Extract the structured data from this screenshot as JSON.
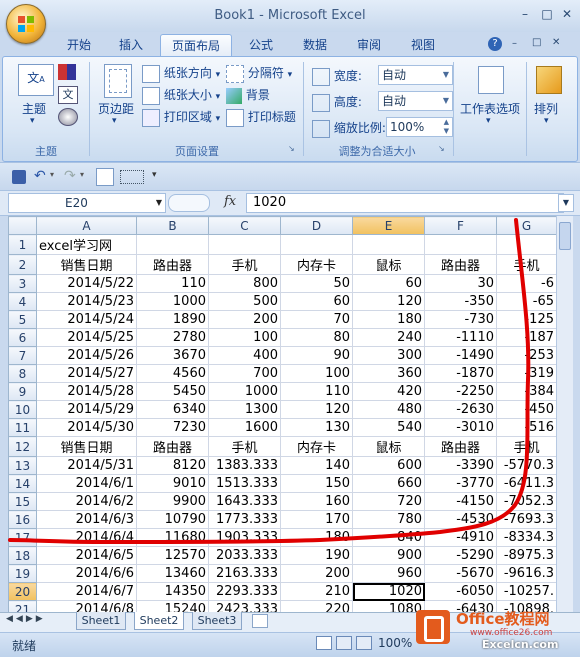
{
  "window": {
    "title": "Book1 - Microsoft Excel"
  },
  "tabs": [
    "开始",
    "插入",
    "页面布局",
    "公式",
    "数据",
    "审阅",
    "视图"
  ],
  "active_tab": "页面布局",
  "ribbon": {
    "theme": {
      "label": "主题",
      "btn": "主题"
    },
    "page_setup": {
      "margins": "页边距",
      "orientation": "纸张方向",
      "size": "纸张大小",
      "print_area": "打印区域",
      "breaks": "分隔符",
      "background": "背景",
      "print_titles": "打印标题",
      "label": "页面设置"
    },
    "scale": {
      "width_label": "宽度:",
      "width_value": "自动",
      "height_label": "高度:",
      "height_value": "自动",
      "scale_label": "缩放比例:",
      "scale_value": "100%",
      "label": "调整为合适大小"
    },
    "sheet_options": "工作表选项",
    "arrange": "排列"
  },
  "formula_bar": {
    "name_box": "E20",
    "fx": "fx",
    "value": "1020"
  },
  "columns": [
    "A",
    "B",
    "C",
    "D",
    "E",
    "F",
    "G"
  ],
  "rows": [
    {
      "n": "1",
      "cells": [
        "excel学习网",
        "",
        "",
        "",
        "",
        "",
        ""
      ]
    },
    {
      "n": "2",
      "cells": [
        "销售日期",
        "路由器",
        "手机",
        "内存卡",
        "鼠标",
        "路由器",
        "手机"
      ]
    },
    {
      "n": "3",
      "cells": [
        "2014/5/22",
        "110",
        "800",
        "50",
        "60",
        "30",
        "-6"
      ]
    },
    {
      "n": "4",
      "cells": [
        "2014/5/23",
        "1000",
        "500",
        "60",
        "120",
        "-350",
        "-65"
      ]
    },
    {
      "n": "5",
      "cells": [
        "2014/5/24",
        "1890",
        "200",
        "70",
        "180",
        "-730",
        "-125"
      ]
    },
    {
      "n": "6",
      "cells": [
        "2014/5/25",
        "2780",
        "100",
        "80",
        "240",
        "-1110",
        "-187"
      ]
    },
    {
      "n": "7",
      "cells": [
        "2014/5/26",
        "3670",
        "400",
        "90",
        "300",
        "-1490",
        "-253"
      ]
    },
    {
      "n": "8",
      "cells": [
        "2014/5/27",
        "4560",
        "700",
        "100",
        "360",
        "-1870",
        "-319"
      ]
    },
    {
      "n": "9",
      "cells": [
        "2014/5/28",
        "5450",
        "1000",
        "110",
        "420",
        "-2250",
        "-384"
      ]
    },
    {
      "n": "10",
      "cells": [
        "2014/5/29",
        "6340",
        "1300",
        "120",
        "480",
        "-2630",
        "-450"
      ]
    },
    {
      "n": "11",
      "cells": [
        "2014/5/30",
        "7230",
        "1600",
        "130",
        "540",
        "-3010",
        "-516"
      ]
    },
    {
      "n": "12",
      "cells": [
        "销售日期",
        "路由器",
        "手机",
        "内存卡",
        "鼠标",
        "路由器",
        "手机"
      ]
    },
    {
      "n": "13",
      "cells": [
        "2014/5/31",
        "8120",
        "1383.333",
        "140",
        "600",
        "-3390",
        "-5770.3"
      ]
    },
    {
      "n": "14",
      "cells": [
        "2014/6/1",
        "9010",
        "1513.333",
        "150",
        "660",
        "-3770",
        "-6411.3"
      ]
    },
    {
      "n": "15",
      "cells": [
        "2014/6/2",
        "9900",
        "1643.333",
        "160",
        "720",
        "-4150",
        "-7052.3"
      ]
    },
    {
      "n": "16",
      "cells": [
        "2014/6/3",
        "10790",
        "1773.333",
        "170",
        "780",
        "-4530",
        "-7693.3"
      ]
    },
    {
      "n": "17",
      "cells": [
        "2014/6/4",
        "11680",
        "1903.333",
        "180",
        "840",
        "-4910",
        "-8334.3"
      ]
    },
    {
      "n": "18",
      "cells": [
        "2014/6/5",
        "12570",
        "2033.333",
        "190",
        "900",
        "-5290",
        "-8975.3"
      ]
    },
    {
      "n": "19",
      "cells": [
        "2014/6/6",
        "13460",
        "2163.333",
        "200",
        "960",
        "-5670",
        "-9616.3"
      ]
    },
    {
      "n": "20",
      "cells": [
        "2014/6/7",
        "14350",
        "2293.333",
        "210",
        "1020",
        "-6050",
        "-10257."
      ]
    },
    {
      "n": "21",
      "cells": [
        "2014/6/8",
        "15240",
        "2423.333",
        "220",
        "1080",
        "-6430",
        "-10898."
      ]
    }
  ],
  "sheets": [
    "Sheet1",
    "Sheet2",
    "Sheet3"
  ],
  "active_sheet": "Sheet2",
  "status": {
    "mode": "就绪",
    "zoom": "100%"
  },
  "watermark": {
    "brand": "Office教程网",
    "url": "www.office26.com",
    "alt": "Excelcn.com"
  },
  "colors": {
    "accent": "#15428b",
    "selection": "#f1c15f",
    "annotation": "#e00000"
  }
}
